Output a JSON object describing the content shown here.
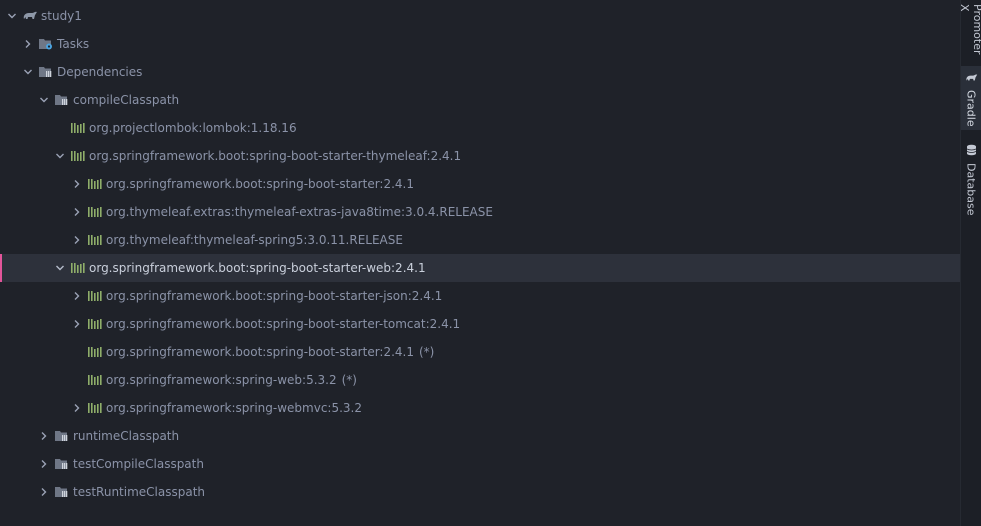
{
  "tree": {
    "root": {
      "label": "study1"
    },
    "tasks": {
      "label": "Tasks"
    },
    "dependencies": {
      "label": "Dependencies"
    },
    "compile_classpath": {
      "label": "compileClasspath"
    },
    "lombok": {
      "label": "org.projectlombok:lombok:1.18.16"
    },
    "thymeleaf_starter": {
      "label": "org.springframework.boot:spring-boot-starter-thymeleaf:2.4.1"
    },
    "boot_starter": {
      "label": "org.springframework.boot:spring-boot-starter:2.4.1"
    },
    "thymeleaf_extras": {
      "label": "org.thymeleaf.extras:thymeleaf-extras-java8time:3.0.4.RELEASE"
    },
    "thymeleaf_spring5": {
      "label": "org.thymeleaf:thymeleaf-spring5:3.0.11.RELEASE"
    },
    "web_starter": {
      "label": "org.springframework.boot:spring-boot-starter-web:2.4.1"
    },
    "json_starter": {
      "label": "org.springframework.boot:spring-boot-starter-json:2.4.1"
    },
    "tomcat_starter": {
      "label": "org.springframework.boot:spring-boot-starter-tomcat:2.4.1"
    },
    "boot_starter_dup": {
      "label": "org.springframework.boot:spring-boot-starter:2.4.1",
      "suffix": "(*)"
    },
    "spring_web": {
      "label": "org.springframework:spring-web:5.3.2",
      "suffix": "(*)"
    },
    "spring_webmvc": {
      "label": "org.springframework:spring-webmvc:5.3.2"
    },
    "runtime_classpath": {
      "label": "runtimeClasspath"
    },
    "test_compile_classpath": {
      "label": "testCompileClasspath"
    },
    "test_runtime_classpath": {
      "label": "testRuntimeClasspath"
    }
  },
  "sidebar": {
    "promoter_x": "Promoter X",
    "gradle": "Gradle",
    "database": "Database"
  },
  "colors": {
    "background": "#1f2229",
    "text": "#8b93a8",
    "selected_row": "#2d313b",
    "selection_marker": "#e2559a",
    "library_icon": "#8fae6a"
  },
  "icons": {
    "expand": "chevron-right-icon",
    "collapse": "chevron-down-icon",
    "gradle": "elephant-icon",
    "folder": "folder-icon",
    "library": "library-bars-icon",
    "database": "database-icon"
  }
}
